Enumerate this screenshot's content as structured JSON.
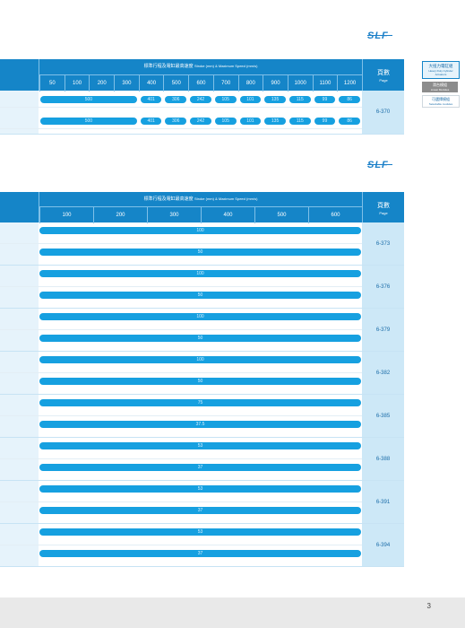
{
  "logo": "SLF",
  "side_tabs": [
    {
      "zh": "大扭力電缸組",
      "en": "Heavy Duty Cylinder Actuators"
    },
    {
      "zh": "滑台模組",
      "en": "Linear Modules"
    },
    {
      "zh": "可選擇模組",
      "en": "Selectable modules"
    }
  ],
  "table1": {
    "title": "標準行程及電缸最高速度",
    "title_en": "Stroke (mm) & Maximum Speed (mm/s)",
    "page_hd_zh": "頁數",
    "page_hd_en": "Page",
    "strokes": [
      "50",
      "100",
      "200",
      "300",
      "400",
      "500",
      "600",
      "700",
      "800",
      "900",
      "1000",
      "1100",
      "1200"
    ],
    "rows": [
      {
        "first": "500",
        "values": [
          "401",
          "306",
          "242",
          "105",
          "101",
          "135",
          "115",
          "99",
          "86"
        ]
      },
      {
        "first": "500",
        "values": [
          "401",
          "306",
          "242",
          "105",
          "101",
          "135",
          "115",
          "99",
          "86"
        ]
      }
    ],
    "page": "6-370"
  },
  "table2": {
    "title": "標準行程及電缸最高速度",
    "title_en": "Stroke (mm) & Maximum Speed (mm/s)",
    "page_hd_zh": "頁數",
    "page_hd_en": "Page",
    "strokes": [
      "100",
      "200",
      "300",
      "400",
      "500",
      "600"
    ],
    "groups": [
      {
        "values": [
          "100",
          "50"
        ],
        "page": "6-373"
      },
      {
        "values": [
          "100",
          "50"
        ],
        "page": "6-376"
      },
      {
        "values": [
          "100",
          "50"
        ],
        "page": "6-379"
      },
      {
        "values": [
          "100",
          "50"
        ],
        "page": "6-382"
      },
      {
        "values": [
          "75",
          "37.5"
        ],
        "page": "6-385"
      },
      {
        "values": [
          "53",
          "37"
        ],
        "page": "6-388"
      },
      {
        "values": [
          "53",
          "37"
        ],
        "page": "6-391"
      },
      {
        "values": [
          "53",
          "37"
        ],
        "page": "6-394"
      }
    ]
  },
  "footer": {
    "page_number": "3"
  }
}
